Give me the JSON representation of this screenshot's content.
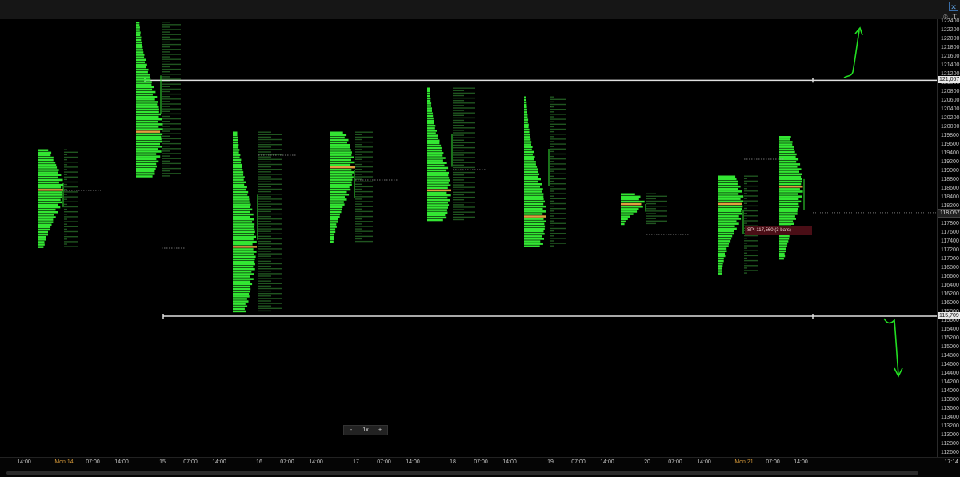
{
  "top_bar": {
    "corner_button": "✕",
    "tools": [
      "⌾",
      "T"
    ]
  },
  "chart_data": {
    "type": "bar",
    "style": "market-profile",
    "colors": {
      "profile": "#33e633",
      "poc": "#e0a040",
      "background": "#000000",
      "level_line": "#e0e0e0",
      "letters": "#3a9a3a"
    },
    "price_axis": {
      "min": 112600,
      "max": 122400,
      "ticks": [
        122400,
        122200,
        122000,
        121800,
        121600,
        121400,
        121200,
        121000,
        120800,
        120600,
        120400,
        120200,
        120000,
        119800,
        119600,
        119400,
        119200,
        119000,
        118800,
        118600,
        118400,
        118200,
        118000,
        117800,
        117600,
        117400,
        117200,
        117000,
        116800,
        116600,
        116400,
        116200,
        116000,
        115800,
        115600,
        115400,
        115200,
        115000,
        114800,
        114600,
        114400,
        114200,
        114000,
        113800,
        113600,
        113400,
        113200,
        113000,
        112800,
        112600
      ]
    },
    "time_axis_labels": [
      {
        "label": "14:00",
        "day": false
      },
      {
        "label": "Mon 14",
        "day": true
      },
      {
        "label": "07:00",
        "day": false
      },
      {
        "label": "14:00",
        "day": false
      },
      {
        "label": "15",
        "day": false
      },
      {
        "label": "07:00",
        "day": false
      },
      {
        "label": "14:00",
        "day": false
      },
      {
        "label": "16",
        "day": false
      },
      {
        "label": "07:00",
        "day": false
      },
      {
        "label": "14:00",
        "day": false
      },
      {
        "label": "17",
        "day": false
      },
      {
        "label": "07:00",
        "day": false
      },
      {
        "label": "14:00",
        "day": false
      },
      {
        "label": "18",
        "day": false
      },
      {
        "label": "07:00",
        "day": false
      },
      {
        "label": "14:00",
        "day": false
      },
      {
        "label": "19",
        "day": false
      },
      {
        "label": "07:00",
        "day": false
      },
      {
        "label": "14:00",
        "day": false
      },
      {
        "label": "20",
        "day": false
      },
      {
        "label": "07:00",
        "day": false
      },
      {
        "label": "14:00",
        "day": false
      },
      {
        "label": "Mon 21",
        "day": true
      },
      {
        "label": "07:00",
        "day": false
      },
      {
        "label": "14:00",
        "day": false
      }
    ],
    "horizontal_levels": [
      {
        "price": 121067,
        "label": "121,067"
      },
      {
        "price": 115709,
        "label": "115,709"
      }
    ],
    "current_price_label": "118,057",
    "profiles": [
      {
        "name": "day-13",
        "low": 117300,
        "high": 119500,
        "poc": 118600,
        "peak": 30
      },
      {
        "name": "day-14",
        "low": 118900,
        "high": 122400,
        "poc": 119900,
        "peak": 32
      },
      {
        "name": "day-15",
        "low": 115800,
        "high": 119900,
        "poc": 117300,
        "peak": 28
      },
      {
        "name": "day-16",
        "low": 117400,
        "high": 119900,
        "poc": 119100,
        "peak": 30
      },
      {
        "name": "day-17",
        "low": 117900,
        "high": 120900,
        "poc": 118600,
        "peak": 28
      },
      {
        "name": "day-18",
        "low": 117300,
        "high": 120700,
        "poc": 118000,
        "peak": 26
      },
      {
        "name": "day-19",
        "low": 117800,
        "high": 118500,
        "poc": 118300,
        "peak": 28
      },
      {
        "name": "day-20",
        "low": 116700,
        "high": 118900,
        "poc": 118300,
        "peak": 30
      },
      {
        "name": "day-21",
        "low": 117000,
        "high": 119800,
        "poc": 118700,
        "peak": 28
      }
    ],
    "annotation": {
      "label": "SP: 117,560 (3 bars)"
    },
    "zoom_controls": {
      "minus": "-",
      "level": "1x",
      "plus": "+"
    }
  },
  "time_axis": {
    "clock_time": "17:14"
  }
}
